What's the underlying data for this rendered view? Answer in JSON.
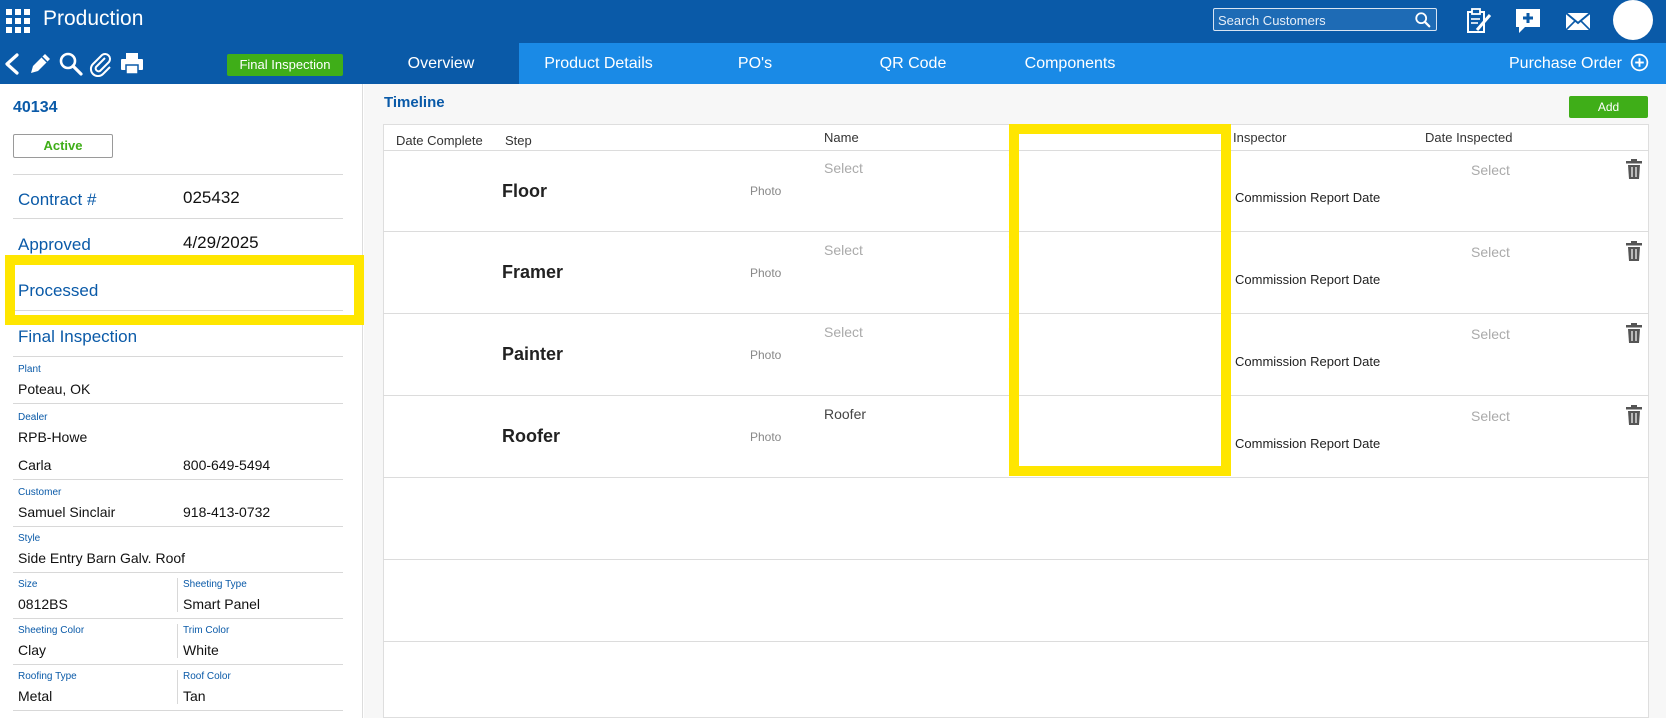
{
  "header": {
    "app_title": "Production",
    "search_placeholder": "Search Customers"
  },
  "toolbar": {
    "stage_badge": "Final Inspection"
  },
  "tabs": [
    {
      "label": "Overview",
      "active": true
    },
    {
      "label": "Product Details",
      "active": false
    },
    {
      "label": "PO's",
      "active": false
    },
    {
      "label": "QR Code",
      "active": false
    },
    {
      "label": "Components",
      "active": false
    }
  ],
  "purchase_order_label": "Purchase Order",
  "left": {
    "order_number": "40134",
    "status": "Active",
    "contract_label": "Contract #",
    "contract_value": "025432",
    "approved_label": "Approved",
    "approved_value": "4/29/2025",
    "processed_label": "Processed",
    "final_inspection_label": "Final Inspection",
    "plant_label": "Plant",
    "plant_value": "Poteau, OK",
    "dealer_label": "Dealer",
    "dealer_value": "RPB-Howe",
    "dealer_contact": "Carla",
    "dealer_phone": "800-649-5494",
    "customer_label": "Customer",
    "customer_value": "Samuel Sinclair",
    "customer_phone": "918-413-0732",
    "style_label": "Style",
    "style_value": "Side Entry Barn Galv. Roof",
    "size_label": "Size",
    "size_value": "0812BS",
    "sheeting_type_label": "Sheeting Type",
    "sheeting_type_value": "Smart Panel",
    "sheeting_color_label": "Sheeting Color",
    "sheeting_color_value": "Clay",
    "trim_color_label": "Trim Color",
    "trim_color_value": "White",
    "roofing_type_label": "Roofing Type",
    "roofing_type_value": "Metal",
    "roof_color_label": "Roof Color",
    "roof_color_value": "Tan"
  },
  "timeline": {
    "title": "Timeline",
    "add_label": "Add",
    "columns": {
      "date_complete": "Date Complete",
      "step": "Step",
      "name": "Name",
      "inspector": "Inspector",
      "date_inspected": "Date Inspected"
    },
    "rows": [
      {
        "step": "Floor",
        "photo": "Photo",
        "name": "Select",
        "name_filled": false,
        "commission": "Commission Report Date",
        "date_inspected": "Select"
      },
      {
        "step": "Framer",
        "photo": "Photo",
        "name": "Select",
        "name_filled": false,
        "commission": "Commission Report Date",
        "date_inspected": "Select"
      },
      {
        "step": "Painter",
        "photo": "Photo",
        "name": "Select",
        "name_filled": false,
        "commission": "Commission Report Date",
        "date_inspected": "Select"
      },
      {
        "step": "Roofer",
        "photo": "Photo",
        "name": "Roofer",
        "name_filled": true,
        "commission": "Commission Report Date",
        "date_inspected": "Select"
      }
    ]
  },
  "colors": {
    "header_blue": "#0a5aa8",
    "tab_blue": "#1a8ae6",
    "accent_green": "#3fae18",
    "highlight_yellow": "#ffe600"
  }
}
